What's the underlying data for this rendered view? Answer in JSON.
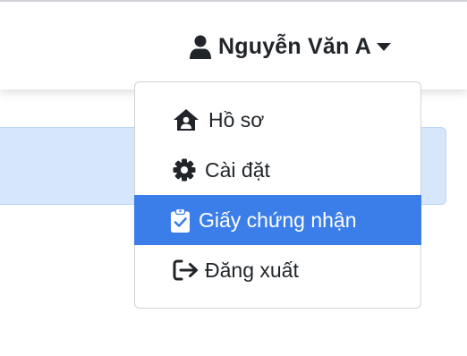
{
  "navbar": {
    "user_icon": "user-icon",
    "user_name": "Nguyễn Văn A",
    "caret_icon": "caret-down-icon"
  },
  "dropdown": {
    "items": [
      {
        "label": "Hồ sơ",
        "icon": "house-user-icon",
        "active": false
      },
      {
        "label": "Cài đặt",
        "icon": "gear-icon",
        "active": false
      },
      {
        "label": "Giấy chứng nhận",
        "icon": "clipboard-check-icon",
        "active": true
      },
      {
        "label": "Đăng xuất",
        "icon": "sign-out-icon",
        "active": false
      }
    ]
  },
  "colors": {
    "active_bg": "#3b7eea",
    "alert_bg": "#d6e6fb",
    "text": "#212529"
  }
}
